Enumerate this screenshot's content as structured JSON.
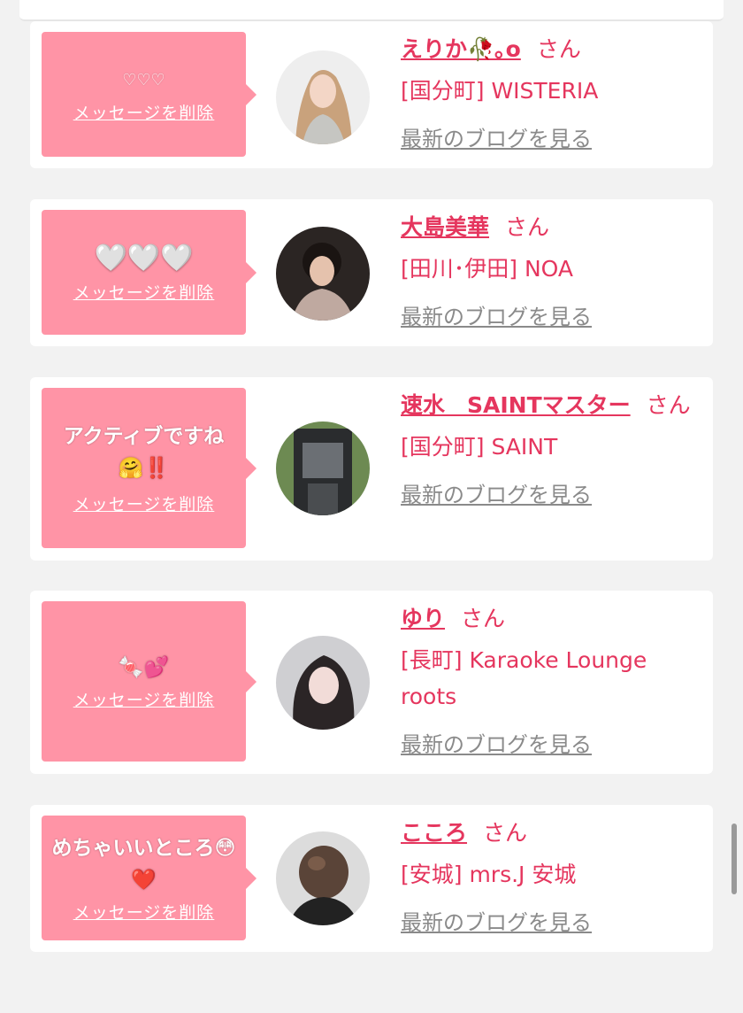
{
  "colors": {
    "accent": "#e5365e",
    "bubble": "#ff94a6",
    "link_gray": "#8a8a8a"
  },
  "cards": [
    {
      "message": "♡♡♡",
      "delete_label": "メッセージを削除",
      "name": "えりか🥀｡o",
      "honorific": "さん",
      "shop": "[国分町] WISTERIA",
      "blog_link": "最新のブログを見る"
    },
    {
      "message": "🤍🤍🤍",
      "delete_label": "メッセージを削除",
      "name": "大島美華",
      "honorific": "さん",
      "shop": "[田川･伊田] NOA",
      "blog_link": "最新のブログを見る"
    },
    {
      "message": "アクティブですね🤗‼️",
      "delete_label": "メッセージを削除",
      "name": "速水　SAINTマスター",
      "honorific": "さん",
      "shop": "[国分町] SAINT",
      "blog_link": "最新のブログを見る"
    },
    {
      "message": "🍬💕",
      "delete_label": "メッセージを削除",
      "name": "ゆり",
      "honorific": "さん",
      "shop": "[長町] Karaoke Lounge roots",
      "blog_link": "最新のブログを見る"
    },
    {
      "message": "めちゃいいところ😳❤️",
      "delete_label": "メッセージを削除",
      "name": "こころ",
      "honorific": "さん",
      "shop": "[安城] mrs.J 安城",
      "blog_link": "最新のブログを見る"
    }
  ]
}
